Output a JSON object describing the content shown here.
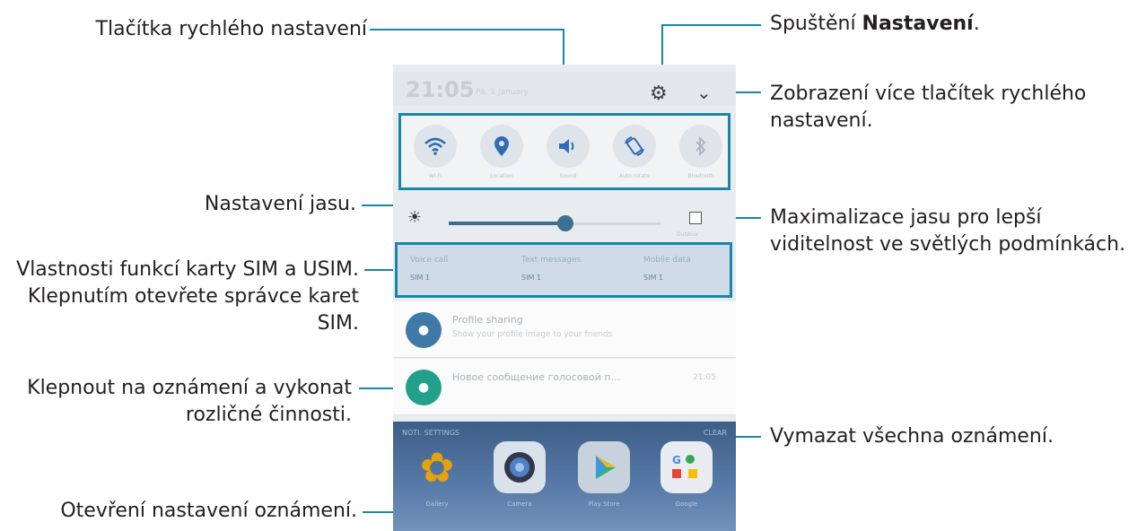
{
  "callouts": {
    "quick_buttons": "Tlačítka rychlého nastavení",
    "launch_settings_prefix": "Spuštění ",
    "launch_settings_bold": "Nastavení",
    "launch_settings_suffix": ".",
    "more_buttons_line1": "Zobrazení více tlačítek rychlého",
    "more_buttons_line2": "nastavení.",
    "brightness": "Nastavení jasu.",
    "max_brightness_line1": "Maximalizace jasu pro lepší",
    "max_brightness_line2": "viditelnost ve světlých podmínkách.",
    "sim_line1": "Vlastnosti funkcí karty SIM a USIM.",
    "sim_line2": "Klepnutím otevřete správce karet",
    "sim_line3": "SIM.",
    "tap_notification_line1": "Klepnout na oznámení a vykonat",
    "tap_notification_line2": "rozličné činnosti.",
    "clear_all": "Vymazat všechna oznámení.",
    "notification_settings": "Otevření nastavení oznámení."
  },
  "phone": {
    "status": {
      "time": "21:05",
      "date": "Pá, 1 January",
      "settings_icon": "gear-icon",
      "expand_icon": "chevron-down-icon"
    },
    "quick_settings": [
      {
        "icon": "wifi-icon",
        "glyph": "📶",
        "label": "Wi-Fi"
      },
      {
        "icon": "location-icon",
        "glyph": "⚲",
        "label": "Location"
      },
      {
        "icon": "sound-icon",
        "glyph": "🔊",
        "label": "Sound"
      },
      {
        "icon": "auto-rotate-icon",
        "glyph": "⟲",
        "label": "Auto rotate"
      },
      {
        "icon": "bluetooth-icon",
        "glyph": "✱",
        "label": "Bluetooth"
      }
    ],
    "brightness": {
      "level": 0.55,
      "outdoor_label": "Outdoor"
    },
    "sim": [
      {
        "title": "Voice call",
        "sub": "SIM 1"
      },
      {
        "title": "Text messages",
        "sub": "SIM 1"
      },
      {
        "title": "Mobile data",
        "sub": "SIM 1"
      }
    ],
    "notifications": [
      {
        "title": "Profile sharing",
        "text": "Show your profile image to your friends",
        "time": "",
        "icon_color": "#3e79a8"
      },
      {
        "title": "Новое сообщение голосовой п...",
        "text": "",
        "time": "21:05",
        "icon_color": "#23a08c"
      }
    ],
    "home": {
      "notification_settings_label": "NOTI. SETTINGS",
      "clear_label": "CLEAR",
      "apps": [
        {
          "label": "Gallery",
          "glyph": "✿",
          "bg": "#e6a20c"
        },
        {
          "label": "Camera",
          "glyph": "◉",
          "bg": "#d9e1ea"
        },
        {
          "label": "Play Store",
          "glyph": "▶",
          "bg": "#c8d2dc"
        },
        {
          "label": "Google",
          "glyph": "G",
          "bg": "#e9edf1"
        }
      ]
    }
  },
  "colors": {
    "accent_line": "#1a86a8",
    "quick_icon": "#2d6db4"
  }
}
